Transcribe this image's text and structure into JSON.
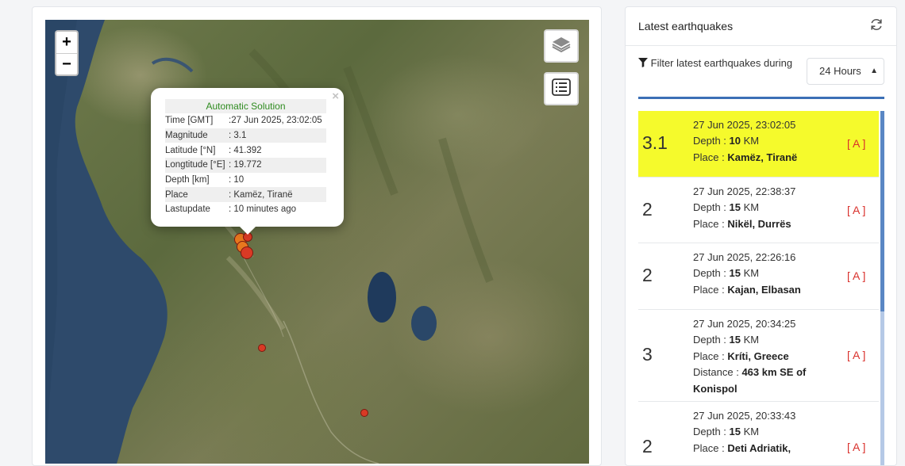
{
  "map": {
    "zoom_in": "+",
    "zoom_out": "−",
    "layers_icon": "layers-icon",
    "list_icon": "list-icon",
    "popup": {
      "title": "Automatic Solution",
      "close": "×",
      "rows": [
        {
          "key": "Time [GMT]",
          "value": ":27 Jun 2025, 23:02:05"
        },
        {
          "key": "Magnitude",
          "value": ": 3.1"
        },
        {
          "key": "Latitude [°N]",
          "value": ": 41.392"
        },
        {
          "key": "Longtitude [°E]",
          "value": ": 19.772"
        },
        {
          "key": "Depth [km]",
          "value": ": 10"
        },
        {
          "key": "Place",
          "value": ": Kamëz, Tiranë"
        },
        {
          "key": "Lastupdate",
          "value": ": 10 minutes ago"
        }
      ]
    },
    "colors": {
      "quake_orange": "#e8781e",
      "quake_red": "#d93a25",
      "sea": "#2e4a6b"
    }
  },
  "sidebar": {
    "title": "Latest earthquakes",
    "refresh_icon": "refresh-icon",
    "filter_icon": "filter-icon",
    "filter_label": "Filter latest earthquakes during",
    "period": "24 Hours",
    "depth_label": "Depth :",
    "place_label": "Place :",
    "distance_label": "Distance :",
    "km_unit": "KM",
    "items": [
      {
        "mag": "3.1",
        "time": "27 Jun 2025, 23:02:05",
        "depth": "10",
        "place": "Kamëz, Tiranë",
        "tag": "[ A ]",
        "highlighted": true
      },
      {
        "mag": "2",
        "time": "27 Jun 2025, 22:38:37",
        "depth": "15",
        "place": "Nikël, Durrës",
        "tag": "[ A ]"
      },
      {
        "mag": "2",
        "time": "27 Jun 2025, 22:26:16",
        "depth": "15",
        "place": "Kajan, Elbasan",
        "tag": "[ A ]"
      },
      {
        "mag": "3",
        "time": "27 Jun 2025, 20:34:25",
        "depth": "15",
        "place": "Kríti, Greece",
        "distance": "463 km SE of Konispol",
        "tag": "[ A ]"
      },
      {
        "mag": "2",
        "time": "27 Jun 2025, 20:33:43",
        "depth": "15",
        "place": "Deti Adriatik,",
        "tag": "[ A ]"
      }
    ],
    "colors": {
      "highlight": "#f5fa2c",
      "accent": "#3b6fb6",
      "tag": "#d9302b"
    }
  }
}
